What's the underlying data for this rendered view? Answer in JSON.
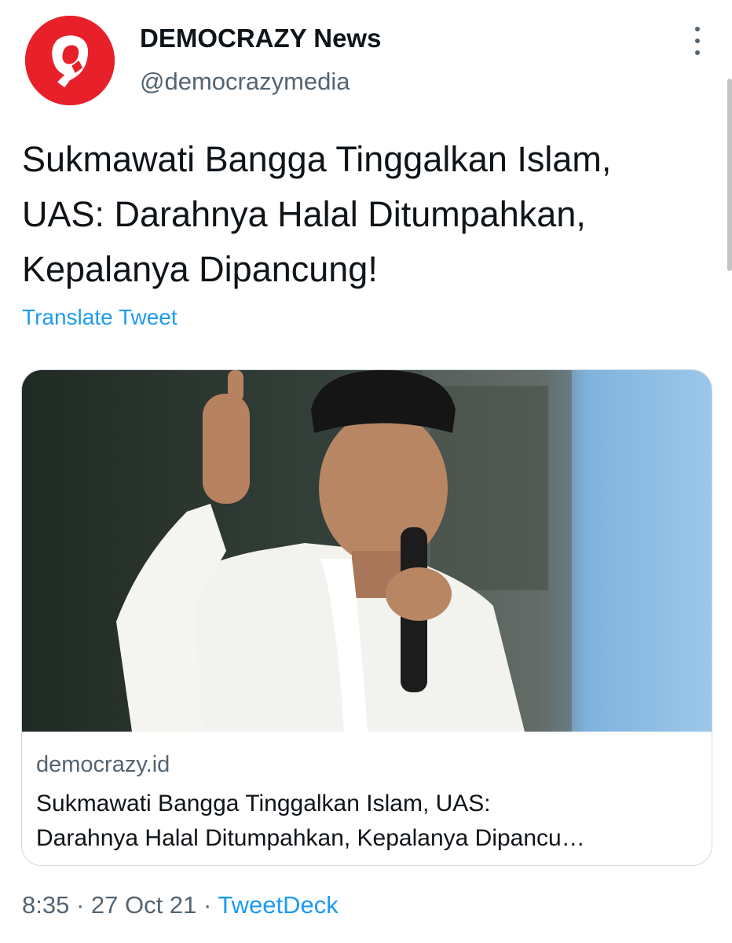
{
  "tweet": {
    "author": {
      "name": "DEMOCRAZY News",
      "handle": "@democrazymedia",
      "avatar_color": "#e8202a"
    },
    "text_lines": [
      "Sukmawati Bangga Tinggalkan Islam,",
      "UAS: Darahnya Halal Ditumpahkan,",
      "Kepalanya Dipancung!"
    ],
    "translate_label": "Translate Tweet",
    "card": {
      "domain": "democrazy.id",
      "title_lines": [
        "Sukmawati Bangga Tinggalkan Islam, UAS:",
        "Darahnya Halal Ditumpahkan, Kepalanya Dipancu…"
      ]
    },
    "meta": {
      "time": "8:35",
      "separator": "·",
      "date": "27 Oct 21",
      "source": "TweetDeck"
    }
  },
  "icons": {
    "more": "more-vertical-icon",
    "avatar": "democrazy-logo-icon"
  },
  "colors": {
    "link": "#1d9bf0",
    "secondary_text": "#536471",
    "primary_text": "#0f1419"
  }
}
